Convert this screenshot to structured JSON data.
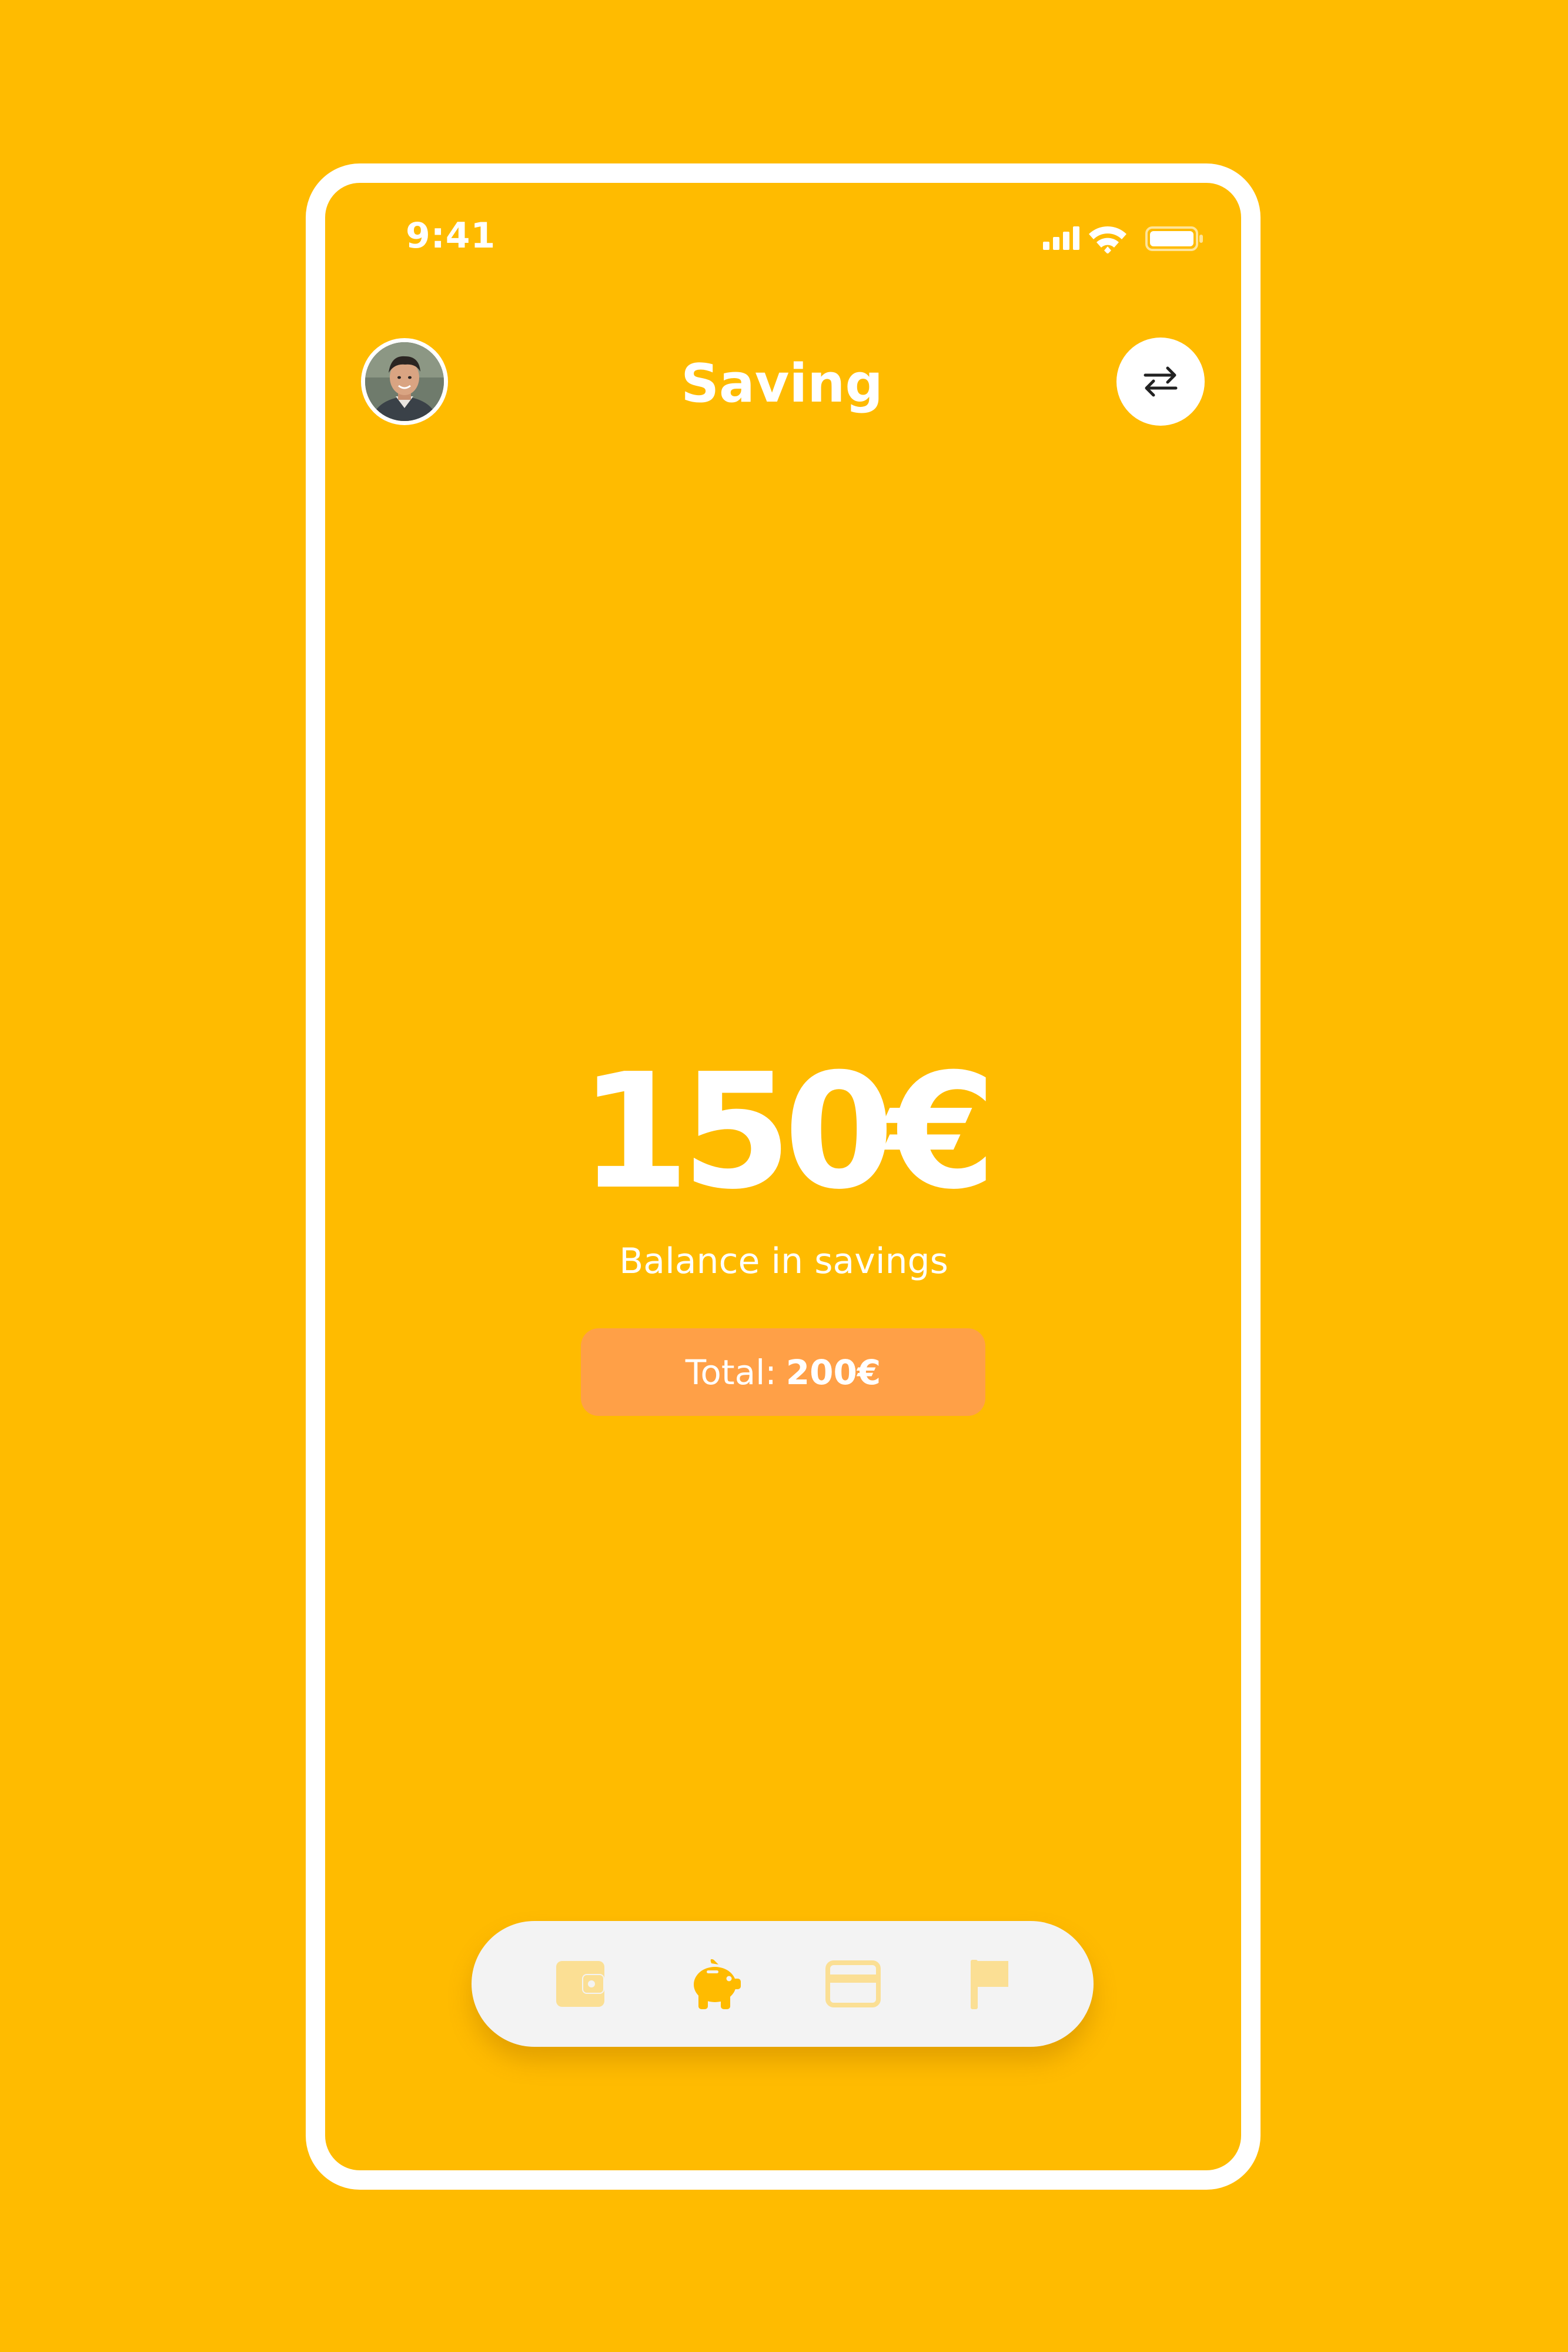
{
  "status_bar": {
    "time": "9:41"
  },
  "header": {
    "title": "Saving"
  },
  "balance": {
    "amount": "150€",
    "label": "Balance in savings"
  },
  "total": {
    "label": "Total:",
    "value": "200€"
  },
  "tab_bar": {
    "tabs": [
      {
        "icon": "wallet-icon",
        "active": false
      },
      {
        "icon": "piggy-bank-icon",
        "active": true
      },
      {
        "icon": "credit-card-icon",
        "active": false
      },
      {
        "icon": "flag-icon",
        "active": false
      }
    ]
  },
  "colors": {
    "background": "#FFBB00",
    "accent_pill": "#FFA047",
    "tab_bar": "#F3F3F3",
    "icon_active": "#FFBB00",
    "icon_inactive": "#FBDF94",
    "text": "#FFFFFF"
  }
}
